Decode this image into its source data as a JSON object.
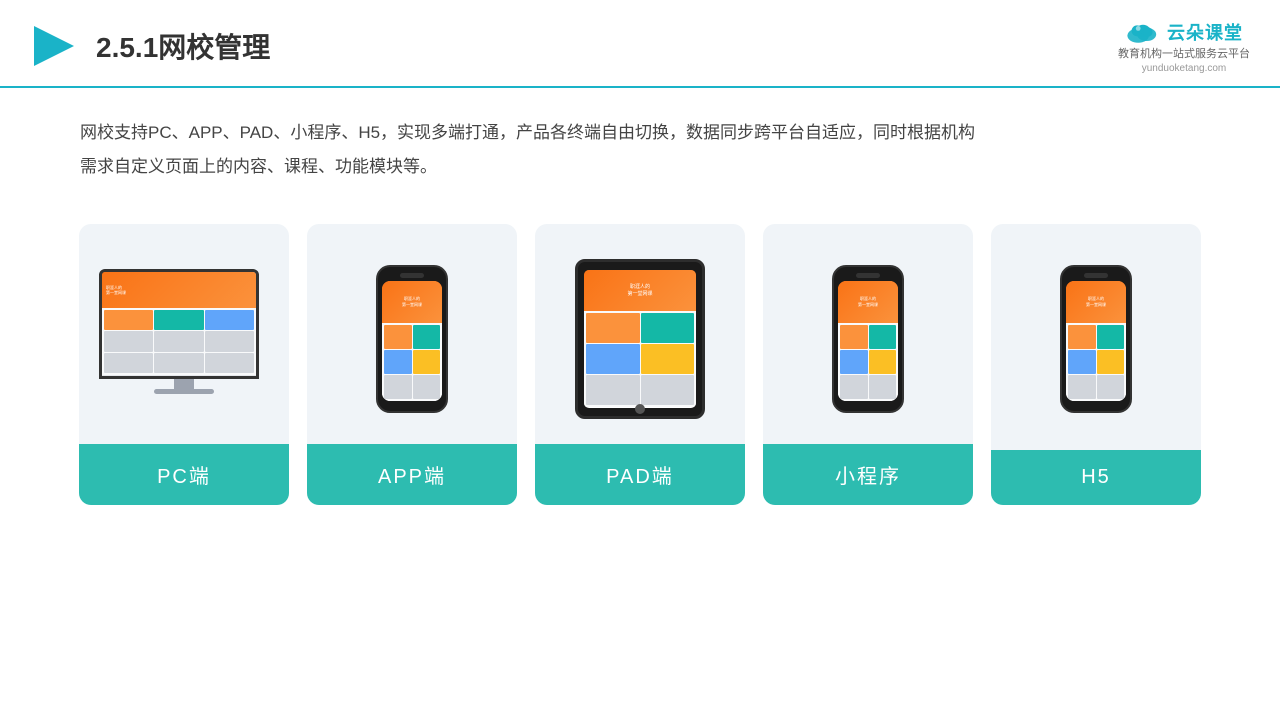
{
  "header": {
    "title": "2.5.1网校管理",
    "logo_text": "云朵课堂",
    "logo_url": "yunduoketang.com",
    "logo_subtitle": "教育机构一站\n式服务云平台"
  },
  "description": {
    "text1": "网校支持PC、APP、PAD、小程序、H5，实现多端打通，产品各终端自由切换，数据同步跨平台自适应，同时根据机构",
    "text2": "需求自定义页面上的内容、课程、功能模块等。"
  },
  "cards": [
    {
      "id": "pc",
      "label": "PC端",
      "type": "pc"
    },
    {
      "id": "app",
      "label": "APP端",
      "type": "phone"
    },
    {
      "id": "pad",
      "label": "PAD端",
      "type": "tablet"
    },
    {
      "id": "miniprogram",
      "label": "小程序",
      "type": "phone"
    },
    {
      "id": "h5",
      "label": "H5",
      "type": "phone"
    }
  ],
  "accent_color": "#2dbcb0"
}
